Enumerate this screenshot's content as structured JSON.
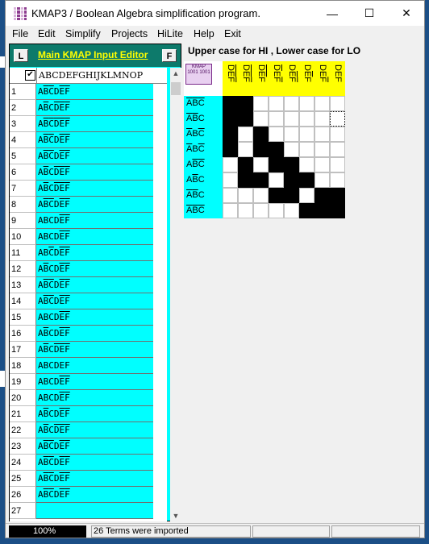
{
  "window": {
    "title": "KMAP3 / Boolean Algebra simplification program.",
    "controls": {
      "minimize": "—",
      "maximize": "☐",
      "close": "✕"
    }
  },
  "menu": [
    "File",
    "Edit",
    "Simplify",
    "Projects",
    "HiLite",
    "Help",
    "Exit"
  ],
  "editor": {
    "left_button": "L",
    "right_button": "F",
    "title": "Main  KMAP Input Editor",
    "header_check": "✔",
    "header_label": "ABCDEFGHIJKLMNOP",
    "rows": [
      {
        "n": "1",
        "v": [
          [
            "A",
            0
          ],
          [
            "B",
            1
          ],
          [
            "C",
            1
          ],
          [
            "D",
            0
          ],
          [
            "E",
            1
          ],
          [
            "F",
            1
          ]
        ]
      },
      {
        "n": "2",
        "v": [
          [
            "A",
            0
          ],
          [
            "B",
            1
          ],
          [
            "C",
            0
          ],
          [
            "D",
            1
          ],
          [
            "E",
            1
          ],
          [
            "F",
            1
          ]
        ]
      },
      {
        "n": "3",
        "v": [
          [
            "A",
            0
          ],
          [
            "B",
            1
          ],
          [
            "C",
            1
          ],
          [
            "D",
            1
          ],
          [
            "E",
            1
          ],
          [
            "F",
            1
          ]
        ]
      },
      {
        "n": "4",
        "v": [
          [
            "A",
            0
          ],
          [
            "B",
            1
          ],
          [
            "C",
            1
          ],
          [
            "D",
            0
          ],
          [
            "E",
            1
          ],
          [
            "F",
            1
          ]
        ]
      },
      {
        "n": "5",
        "v": [
          [
            "A",
            0
          ],
          [
            "B",
            1
          ],
          [
            "C",
            1
          ],
          [
            "D",
            0
          ],
          [
            "E",
            1
          ],
          [
            "F",
            1
          ]
        ]
      },
      {
        "n": "6",
        "v": [
          [
            "A",
            0
          ],
          [
            "B",
            1
          ],
          [
            "C",
            0
          ],
          [
            "D",
            1
          ],
          [
            "E",
            1
          ],
          [
            "F",
            1
          ]
        ]
      },
      {
        "n": "7",
        "v": [
          [
            "A",
            0
          ],
          [
            "B",
            1
          ],
          [
            "C",
            0
          ],
          [
            "D",
            1
          ],
          [
            "E",
            1
          ],
          [
            "F",
            1
          ]
        ]
      },
      {
        "n": "8",
        "v": [
          [
            "A",
            0
          ],
          [
            "B",
            1
          ],
          [
            "C",
            1
          ],
          [
            "D",
            0
          ],
          [
            "E",
            1
          ],
          [
            "F",
            1
          ]
        ]
      },
      {
        "n": "9",
        "v": [
          [
            "A",
            0
          ],
          [
            "B",
            0
          ],
          [
            "C",
            0
          ],
          [
            "D",
            0
          ],
          [
            "E",
            1
          ],
          [
            "F",
            1
          ]
        ]
      },
      {
        "n": "10",
        "v": [
          [
            "A",
            0
          ],
          [
            "B",
            0
          ],
          [
            "C",
            0
          ],
          [
            "D",
            0
          ],
          [
            "E",
            1
          ],
          [
            "F",
            1
          ]
        ]
      },
      {
        "n": "11",
        "v": [
          [
            "A",
            0
          ],
          [
            "B",
            0
          ],
          [
            "C",
            1
          ],
          [
            "D",
            0
          ],
          [
            "E",
            1
          ],
          [
            "F",
            1
          ]
        ]
      },
      {
        "n": "12",
        "v": [
          [
            "A",
            0
          ],
          [
            "B",
            1
          ],
          [
            "C",
            0
          ],
          [
            "D",
            0
          ],
          [
            "E",
            1
          ],
          [
            "F",
            1
          ]
        ]
      },
      {
        "n": "13",
        "v": [
          [
            "A",
            0
          ],
          [
            "B",
            1
          ],
          [
            "C",
            1
          ],
          [
            "D",
            0
          ],
          [
            "E",
            1
          ],
          [
            "F",
            1
          ]
        ]
      },
      {
        "n": "14",
        "v": [
          [
            "A",
            0
          ],
          [
            "B",
            1
          ],
          [
            "C",
            1
          ],
          [
            "D",
            0
          ],
          [
            "E",
            1
          ],
          [
            "F",
            1
          ]
        ]
      },
      {
        "n": "15",
        "v": [
          [
            "A",
            0
          ],
          [
            "B",
            0
          ],
          [
            "C",
            0
          ],
          [
            "D",
            0
          ],
          [
            "E",
            1
          ],
          [
            "F",
            1
          ]
        ]
      },
      {
        "n": "16",
        "v": [
          [
            "A",
            0
          ],
          [
            "B",
            1
          ],
          [
            "C",
            0
          ],
          [
            "D",
            0
          ],
          [
            "E",
            1
          ],
          [
            "F",
            1
          ]
        ]
      },
      {
        "n": "17",
        "v": [
          [
            "A",
            0
          ],
          [
            "B",
            1
          ],
          [
            "C",
            0
          ],
          [
            "D",
            1
          ],
          [
            "E",
            1
          ],
          [
            "F",
            1
          ]
        ]
      },
      {
        "n": "18",
        "v": [
          [
            "A",
            0
          ],
          [
            "B",
            0
          ],
          [
            "C",
            0
          ],
          [
            "D",
            0
          ],
          [
            "E",
            0
          ],
          [
            "F",
            0
          ]
        ]
      },
      {
        "n": "19",
        "v": [
          [
            "A",
            0
          ],
          [
            "B",
            0
          ],
          [
            "C",
            0
          ],
          [
            "D",
            0
          ],
          [
            "E",
            1
          ],
          [
            "F",
            1
          ]
        ]
      },
      {
        "n": "20",
        "v": [
          [
            "A",
            0
          ],
          [
            "B",
            0
          ],
          [
            "C",
            0
          ],
          [
            "D",
            0
          ],
          [
            "E",
            1
          ],
          [
            "F",
            1
          ]
        ]
      },
      {
        "n": "21",
        "v": [
          [
            "A",
            0
          ],
          [
            "B",
            1
          ],
          [
            "C",
            0
          ],
          [
            "D",
            0
          ],
          [
            "E",
            1
          ],
          [
            "F",
            1
          ]
        ]
      },
      {
        "n": "22",
        "v": [
          [
            "A",
            0
          ],
          [
            "B",
            1
          ],
          [
            "C",
            0
          ],
          [
            "D",
            1
          ],
          [
            "E",
            1
          ],
          [
            "F",
            1
          ]
        ]
      },
      {
        "n": "23",
        "v": [
          [
            "A",
            0
          ],
          [
            "B",
            1
          ],
          [
            "C",
            1
          ],
          [
            "D",
            0
          ],
          [
            "E",
            1
          ],
          [
            "F",
            1
          ]
        ]
      },
      {
        "n": "24",
        "v": [
          [
            "A",
            0
          ],
          [
            "B",
            1
          ],
          [
            "C",
            1
          ],
          [
            "D",
            0
          ],
          [
            "E",
            1
          ],
          [
            "F",
            1
          ]
        ]
      },
      {
        "n": "25",
        "v": [
          [
            "A",
            0
          ],
          [
            "B",
            1
          ],
          [
            "C",
            1
          ],
          [
            "D",
            0
          ],
          [
            "E",
            1
          ],
          [
            "F",
            1
          ]
        ]
      },
      {
        "n": "26",
        "v": [
          [
            "A",
            0
          ],
          [
            "B",
            1
          ],
          [
            "C",
            1
          ],
          [
            "D",
            0
          ],
          [
            "E",
            1
          ],
          [
            "F",
            1
          ]
        ]
      },
      {
        "n": "27",
        "v": []
      }
    ]
  },
  "kmap": {
    "title": "Upper case for HI ,  Lower case for LO",
    "corner_text": "KMAP 1001 1001",
    "col_headers": [
      [
        [
          "D",
          1
        ],
        [
          "E",
          1
        ],
        [
          "F",
          1
        ]
      ],
      [
        [
          "D",
          1
        ],
        [
          "E",
          1
        ],
        [
          "F",
          1
        ]
      ],
      [
        [
          "D",
          1
        ],
        [
          "E",
          1
        ],
        [
          "F",
          0
        ]
      ],
      [
        [
          "D",
          1
        ],
        [
          "E",
          0
        ],
        [
          "F",
          1
        ]
      ],
      [
        [
          "D",
          0
        ],
        [
          "E",
          1
        ],
        [
          "F",
          1
        ]
      ],
      [
        [
          "D",
          0
        ],
        [
          "E",
          1
        ],
        [
          "F",
          0
        ]
      ],
      [
        [
          "D",
          0
        ],
        [
          "E",
          0
        ],
        [
          "F",
          1
        ]
      ],
      [
        [
          "D",
          0
        ],
        [
          "E",
          0
        ],
        [
          "F",
          0
        ]
      ]
    ],
    "row_headers": [
      [
        [
          "A",
          1
        ],
        [
          "B",
          1
        ],
        [
          "C",
          1
        ]
      ],
      [
        [
          "A",
          1
        ],
        [
          "B",
          1
        ],
        [
          "C",
          0
        ]
      ],
      [
        [
          "A",
          1
        ],
        [
          "B",
          0
        ],
        [
          "C",
          1
        ]
      ],
      [
        [
          "A",
          1
        ],
        [
          "B",
          0
        ],
        [
          "C",
          1
        ]
      ],
      [
        [
          "A",
          0
        ],
        [
          "B",
          1
        ],
        [
          "C",
          1
        ]
      ],
      [
        [
          "A",
          0
        ],
        [
          "B",
          1
        ],
        [
          "C",
          0
        ]
      ],
      [
        [
          "A",
          1
        ],
        [
          "B",
          1
        ],
        [
          "C",
          0
        ]
      ],
      [
        [
          "A",
          1
        ],
        [
          "B",
          1
        ],
        [
          "C",
          1
        ]
      ]
    ],
    "cells": [
      [
        1,
        1,
        0,
        0,
        0,
        0,
        0,
        0
      ],
      [
        1,
        1,
        0,
        0,
        0,
        0,
        0,
        2
      ],
      [
        1,
        0,
        1,
        0,
        0,
        0,
        0,
        0
      ],
      [
        1,
        0,
        1,
        1,
        0,
        0,
        0,
        0
      ],
      [
        0,
        1,
        0,
        1,
        1,
        0,
        0,
        0
      ],
      [
        0,
        1,
        1,
        0,
        1,
        1,
        0,
        0
      ],
      [
        0,
        0,
        0,
        1,
        1,
        0,
        1,
        1
      ],
      [
        0,
        0,
        0,
        0,
        0,
        1,
        1,
        1
      ]
    ]
  },
  "status": {
    "zoom": "100%",
    "message": "26 Terms were imported"
  },
  "colors": {
    "cyan": "#00ffff",
    "yellow": "#ffff00",
    "header_green": "#0d7a6b"
  }
}
